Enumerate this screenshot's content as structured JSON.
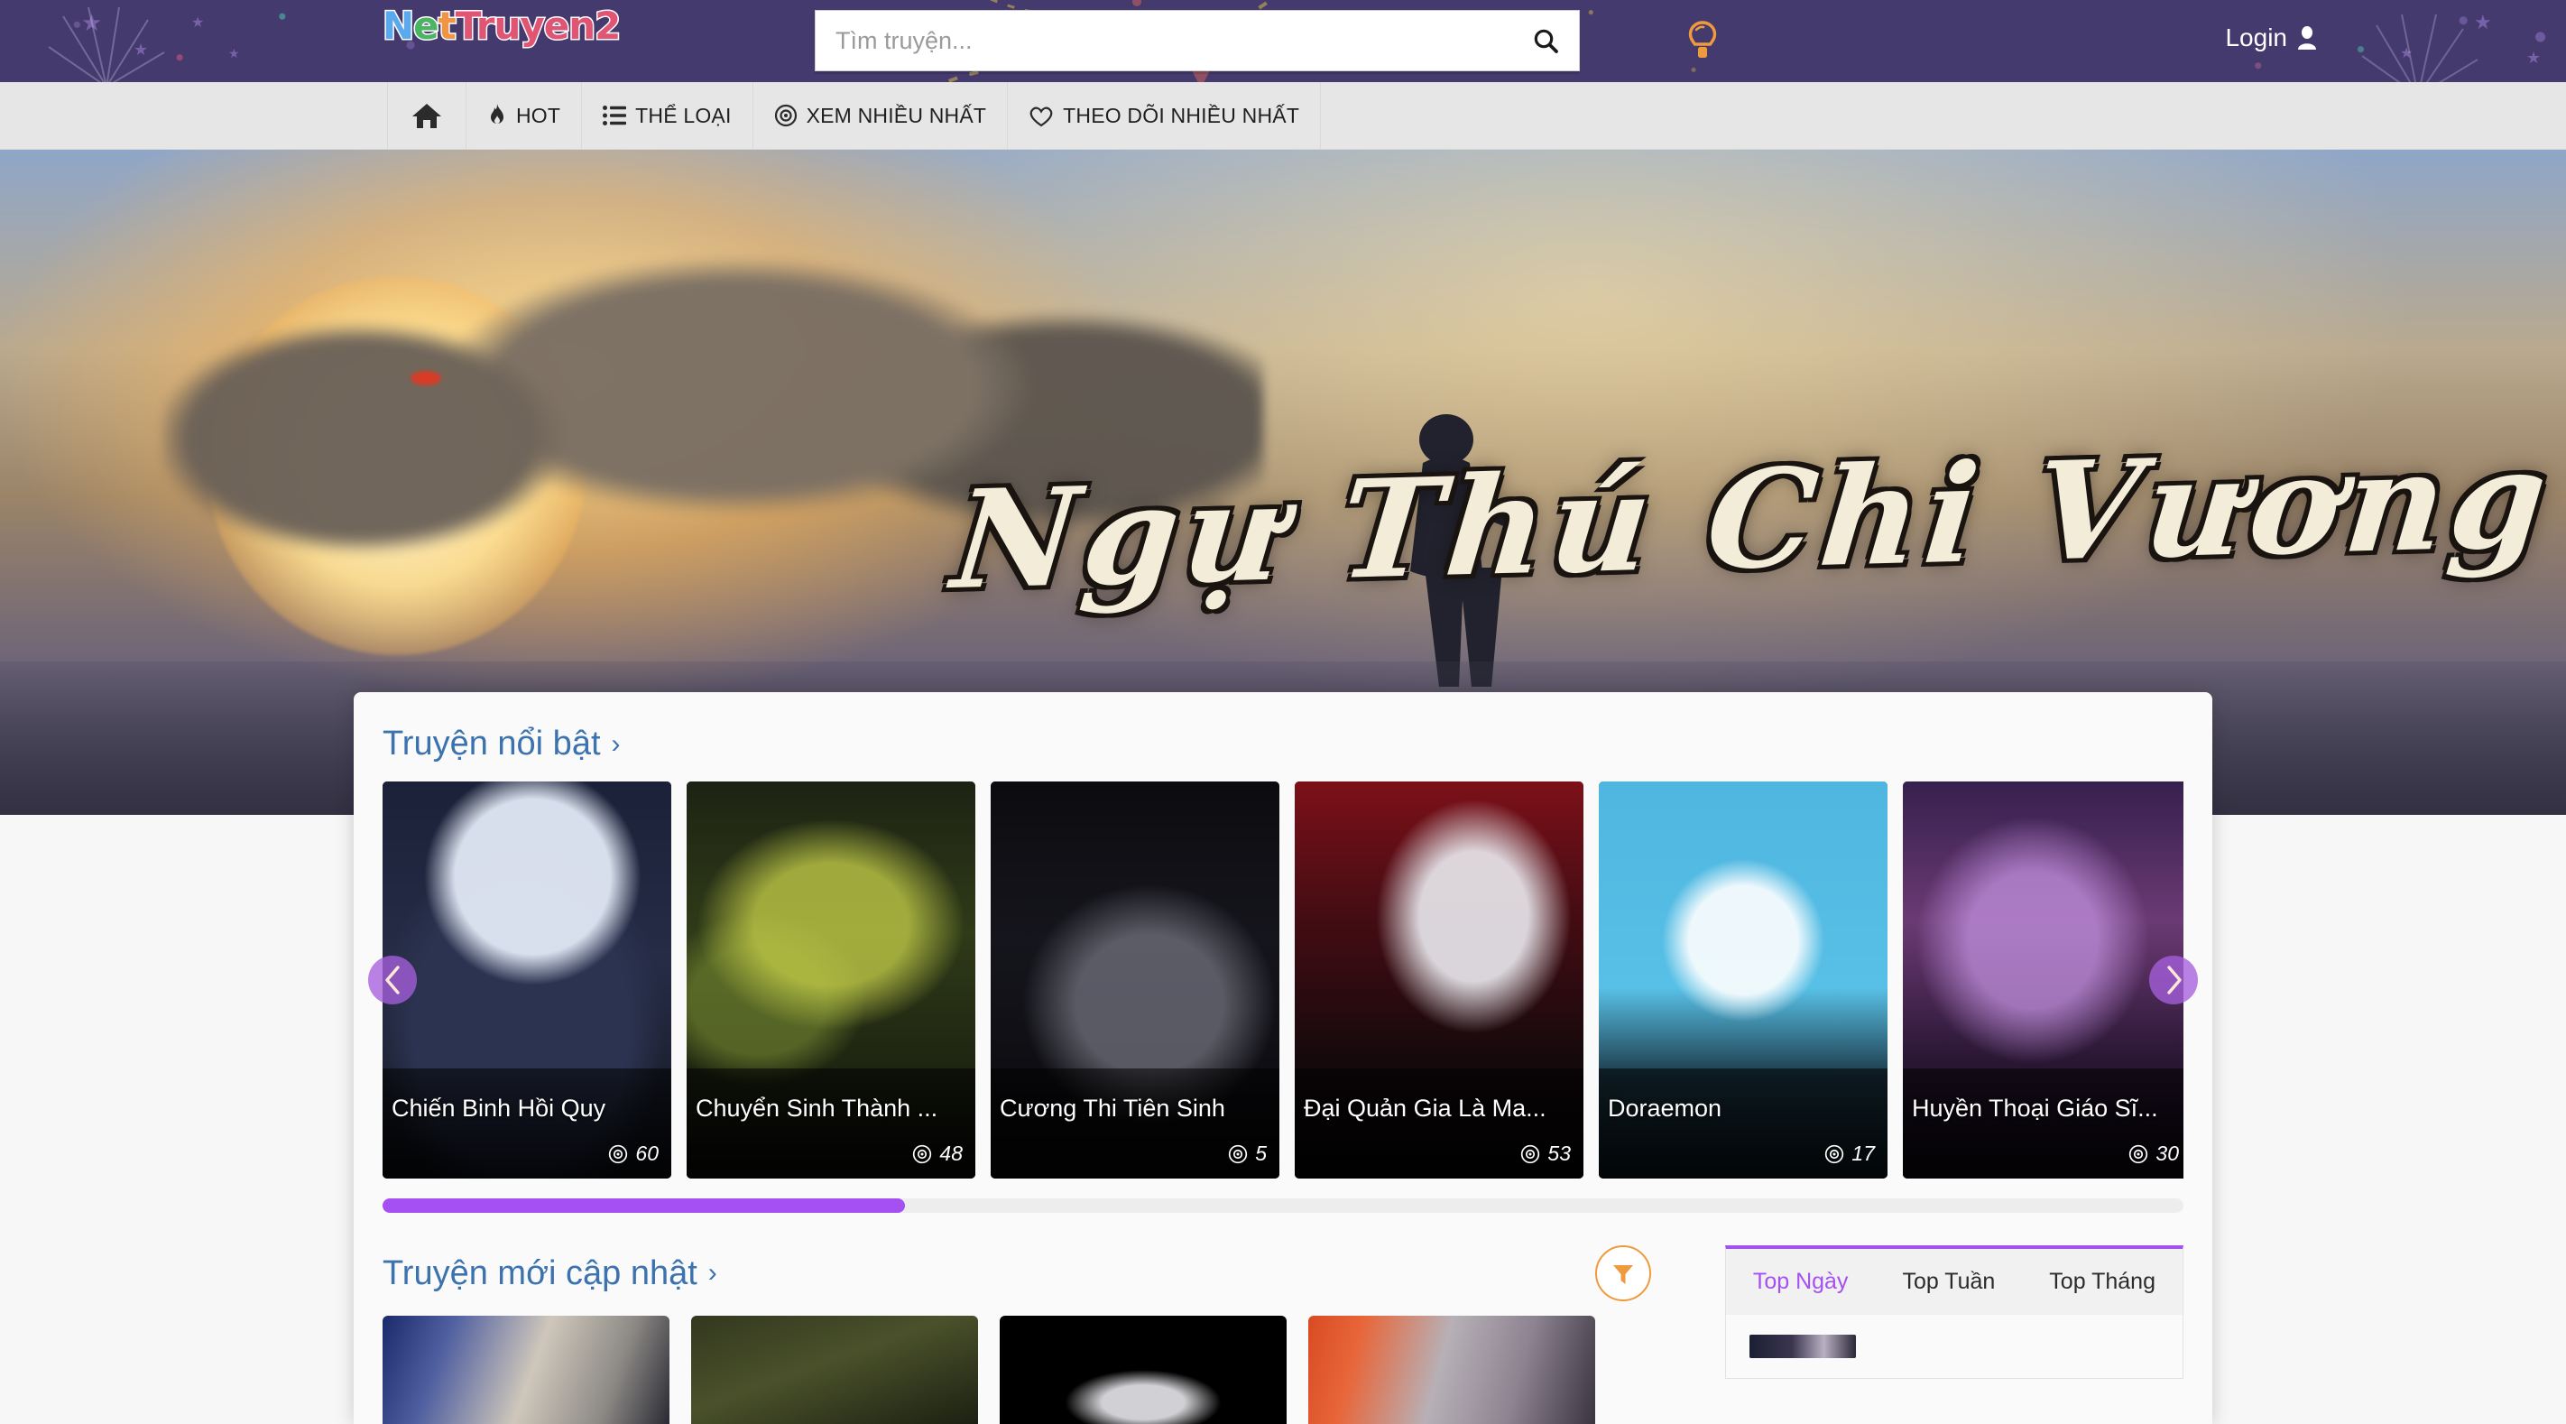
{
  "site": {
    "logo_parts": [
      "N",
      "e",
      "t",
      "Truyen2"
    ],
    "logo_full": "NetTruyen2"
  },
  "header": {
    "search": {
      "placeholder": "Tìm truyện...",
      "value": "",
      "icon": "search-icon"
    },
    "theme_toggle_icon": "lightbulb-icon",
    "login_label": "Login",
    "login_icon": "user-icon",
    "background_color": "#453a6e"
  },
  "nav": {
    "items": [
      {
        "label": "",
        "icon": "home-icon",
        "name": "home"
      },
      {
        "label": "HOT",
        "icon": "flame-icon",
        "name": "hot"
      },
      {
        "label": "THỂ LOẠI",
        "icon": "list-icon",
        "name": "the-loai"
      },
      {
        "label": "XEM NHIỀU NHẤT",
        "icon": "eye-icon",
        "name": "xem-nhieu-nhat"
      },
      {
        "label": "THEO DÕI NHIỀU NHẤT",
        "icon": "heart-icon",
        "name": "theo-doi-nhieu-nhat"
      }
    ]
  },
  "hero": {
    "title": "Ngự Thú Chi Vương"
  },
  "featured": {
    "title": "Truyện nổi bật",
    "chevron": "›",
    "prev_icon": "chevron-left-icon",
    "next_icon": "chevron-right-icon",
    "scroll_percent": 29,
    "accent_color": "#a550f2",
    "cards": [
      {
        "title": "Chiến Binh Hồi Quy",
        "views": "60",
        "view_icon": "eye-icon"
      },
      {
        "title": "Chuyển Sinh Thành ...",
        "views": "48",
        "view_icon": "eye-icon"
      },
      {
        "title": "Cương Thi Tiên Sinh",
        "views": "5",
        "view_icon": "eye-icon"
      },
      {
        "title": "Đại Quản Gia Là Ma...",
        "views": "53",
        "view_icon": "eye-icon"
      },
      {
        "title": "Doraemon",
        "views": "17",
        "view_icon": "eye-icon"
      },
      {
        "title": "Huyền Thoại Giáo Sĩ...",
        "views": "30",
        "view_icon": "eye-icon"
      }
    ]
  },
  "latest": {
    "title": "Truyện mới cập nhật",
    "chevron": "›",
    "filter_icon": "filter-funnel-icon",
    "filter_color": "#ef9a3d"
  },
  "top_panel": {
    "tabs": [
      {
        "label": "Top Ngày",
        "active": true
      },
      {
        "label": "Top Tuần",
        "active": false
      },
      {
        "label": "Top Tháng",
        "active": false
      }
    ],
    "active_color": "#a550f2"
  }
}
